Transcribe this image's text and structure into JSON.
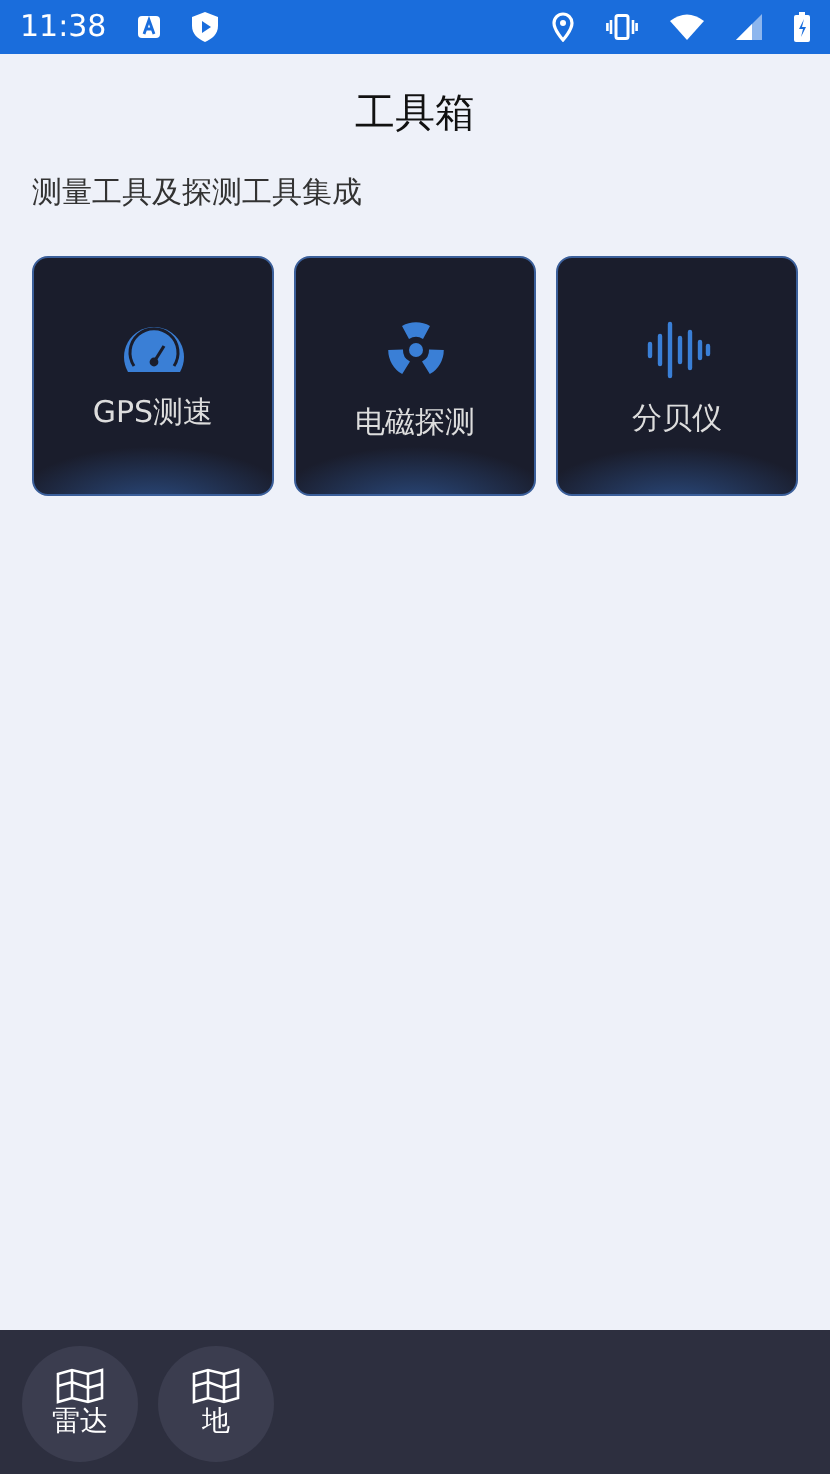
{
  "status_bar": {
    "time": "11:38"
  },
  "title": "工具箱",
  "subtitle": "测量工具及探测工具集成",
  "tools": [
    {
      "kind": "speed",
      "label": "GPS测速"
    },
    {
      "kind": "radiation",
      "label": "电磁探测"
    },
    {
      "kind": "sound",
      "label": "分贝仪"
    }
  ],
  "tab_bar": [
    {
      "label": "雷达"
    },
    {
      "label": "地"
    }
  ]
}
